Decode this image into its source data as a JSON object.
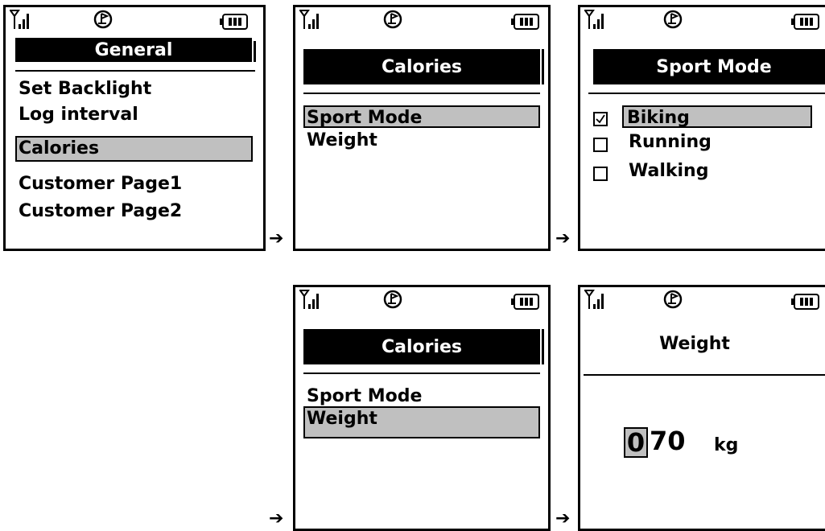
{
  "screens": {
    "general": {
      "title": "General",
      "items": [
        "Set Backlight",
        "Log interval",
        "Calories",
        "Customer Page1",
        "Customer Page2"
      ],
      "selected": "Calories"
    },
    "calories_sport": {
      "title": "Calories",
      "items": [
        "Sport Mode",
        "Weight"
      ],
      "selected": "Sport Mode"
    },
    "sport_mode": {
      "title": "Sport Mode",
      "options": [
        {
          "label": "Biking",
          "checked": true,
          "selected": true
        },
        {
          "label": "Running",
          "checked": false,
          "selected": false
        },
        {
          "label": "Walking",
          "checked": false,
          "selected": false
        }
      ]
    },
    "calories_weight": {
      "title": "Calories",
      "items": [
        "Sport Mode",
        "Weight"
      ],
      "selected": "Weight"
    },
    "weight": {
      "title": "Weight",
      "value_selected_digit": "0",
      "value_rest": "70",
      "unit": "kg"
    }
  },
  "arrows": [
    "➔",
    "➔",
    "➔",
    "➔"
  ]
}
